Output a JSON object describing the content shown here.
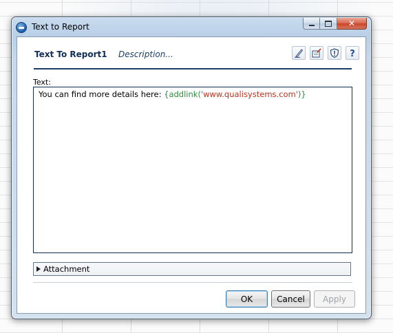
{
  "window": {
    "title": "Text to Report",
    "caption": {
      "minimize": "–",
      "maximize": "□",
      "close": "✕"
    }
  },
  "header": {
    "name": "Text To Report1",
    "description": "Description...",
    "tools": [
      "edit-pencil-icon",
      "properties-icon",
      "shield-icon",
      "help-icon"
    ]
  },
  "text_field": {
    "label": "Text:",
    "prefix": "You can find more details here: ",
    "fn_open": "{addlink(",
    "string": "'www.qualisystems.com'",
    "fn_close": ")}"
  },
  "attachment": {
    "label": "Attachment"
  },
  "buttons": {
    "ok": "OK",
    "cancel": "Cancel",
    "apply": "Apply"
  },
  "colors": {
    "header_text": "#0f2f57",
    "accent_line": "#183b67",
    "function_token": "#2a8c3a",
    "string_token": "#b8321d",
    "close_button": "#c7452b"
  }
}
